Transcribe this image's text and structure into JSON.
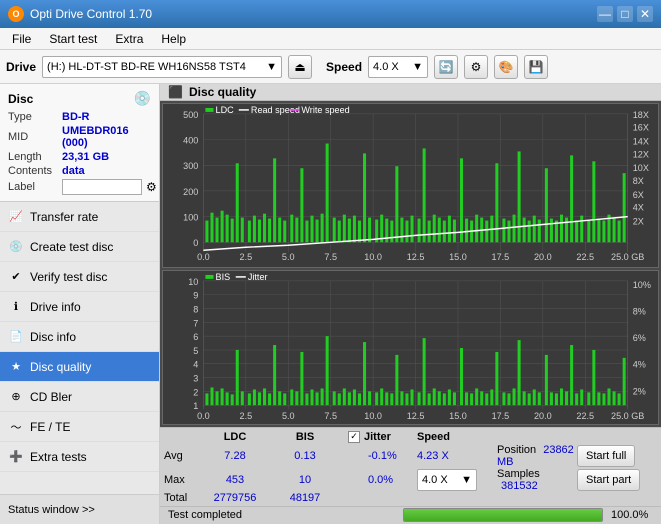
{
  "app": {
    "title": "Opti Drive Control 1.70",
    "icon": "O"
  },
  "titlebar": {
    "minimize": "—",
    "maximize": "□",
    "close": "✕"
  },
  "menubar": {
    "items": [
      "File",
      "Start test",
      "Extra",
      "Help"
    ]
  },
  "toolbar": {
    "drive_label": "Drive",
    "drive_value": "(H:)  HL-DT-ST BD-RE  WH16NS58 TST4",
    "speed_label": "Speed",
    "speed_value": "4.0 X"
  },
  "disc": {
    "title": "Disc",
    "type_label": "Type",
    "type_value": "BD-R",
    "mid_label": "MID",
    "mid_value": "UMEBDR016 (000)",
    "length_label": "Length",
    "length_value": "23,31 GB",
    "contents_label": "Contents",
    "contents_value": "data",
    "label_label": "Label"
  },
  "nav": {
    "items": [
      {
        "id": "transfer-rate",
        "label": "Transfer rate",
        "icon": "📈"
      },
      {
        "id": "create-test-disc",
        "label": "Create test disc",
        "icon": "💿"
      },
      {
        "id": "verify-test-disc",
        "label": "Verify test disc",
        "icon": "✔"
      },
      {
        "id": "drive-info",
        "label": "Drive info",
        "icon": "ℹ"
      },
      {
        "id": "disc-info",
        "label": "Disc info",
        "icon": "📄"
      },
      {
        "id": "disc-quality",
        "label": "Disc quality",
        "icon": "★",
        "active": true
      },
      {
        "id": "cd-bler",
        "label": "CD Bler",
        "icon": "⊕"
      },
      {
        "id": "fe-te",
        "label": "FE / TE",
        "icon": "~"
      },
      {
        "id": "extra-tests",
        "label": "Extra tests",
        "icon": "➕"
      }
    ]
  },
  "status_window": {
    "label": "Status window >>"
  },
  "disc_quality": {
    "title": "Disc quality",
    "legend": {
      "ldc": "LDC",
      "read_speed": "Read speed",
      "write_speed": "Write speed",
      "bis": "BIS",
      "jitter": "Jitter"
    }
  },
  "chart1": {
    "y_max": 500,
    "y_labels": [
      "500",
      "400",
      "300",
      "200",
      "100",
      "0"
    ],
    "y_right": [
      "18X",
      "16X",
      "14X",
      "12X",
      "10X",
      "8X",
      "6X",
      "4X",
      "2X"
    ],
    "x_labels": [
      "0.0",
      "2.5",
      "5.0",
      "7.5",
      "10.0",
      "12.5",
      "15.0",
      "17.5",
      "20.0",
      "22.5",
      "25.0 GB"
    ]
  },
  "chart2": {
    "y_max": 10,
    "y_labels": [
      "10",
      "9",
      "8",
      "7",
      "6",
      "5",
      "4",
      "3",
      "2",
      "1"
    ],
    "y_right": [
      "10%",
      "8%",
      "6%",
      "4%",
      "2%"
    ],
    "x_labels": [
      "0.0",
      "2.5",
      "5.0",
      "7.5",
      "10.0",
      "12.5",
      "15.0",
      "17.5",
      "20.0",
      "22.5",
      "25.0 GB"
    ]
  },
  "stats": {
    "col_headers": [
      "",
      "LDC",
      "BIS",
      "",
      "Jitter",
      "Speed"
    ],
    "rows": [
      {
        "label": "Avg",
        "ldc": "7.28",
        "bis": "0.13",
        "jitter": "-0.1%"
      },
      {
        "label": "Max",
        "ldc": "453",
        "bis": "10",
        "jitter": "0.0%"
      },
      {
        "label": "Total",
        "ldc": "2779756",
        "bis": "48197",
        "jitter": ""
      }
    ],
    "jitter_checked": true,
    "speed_avg": "4.23 X",
    "speed_select": "4.0 X",
    "position_label": "Position",
    "position_value": "23862 MB",
    "samples_label": "Samples",
    "samples_value": "381532"
  },
  "buttons": {
    "start_full": "Start full",
    "start_part": "Start part"
  },
  "app_status": {
    "text": "Test completed",
    "progress": 100,
    "progress_text": "100.0%"
  }
}
